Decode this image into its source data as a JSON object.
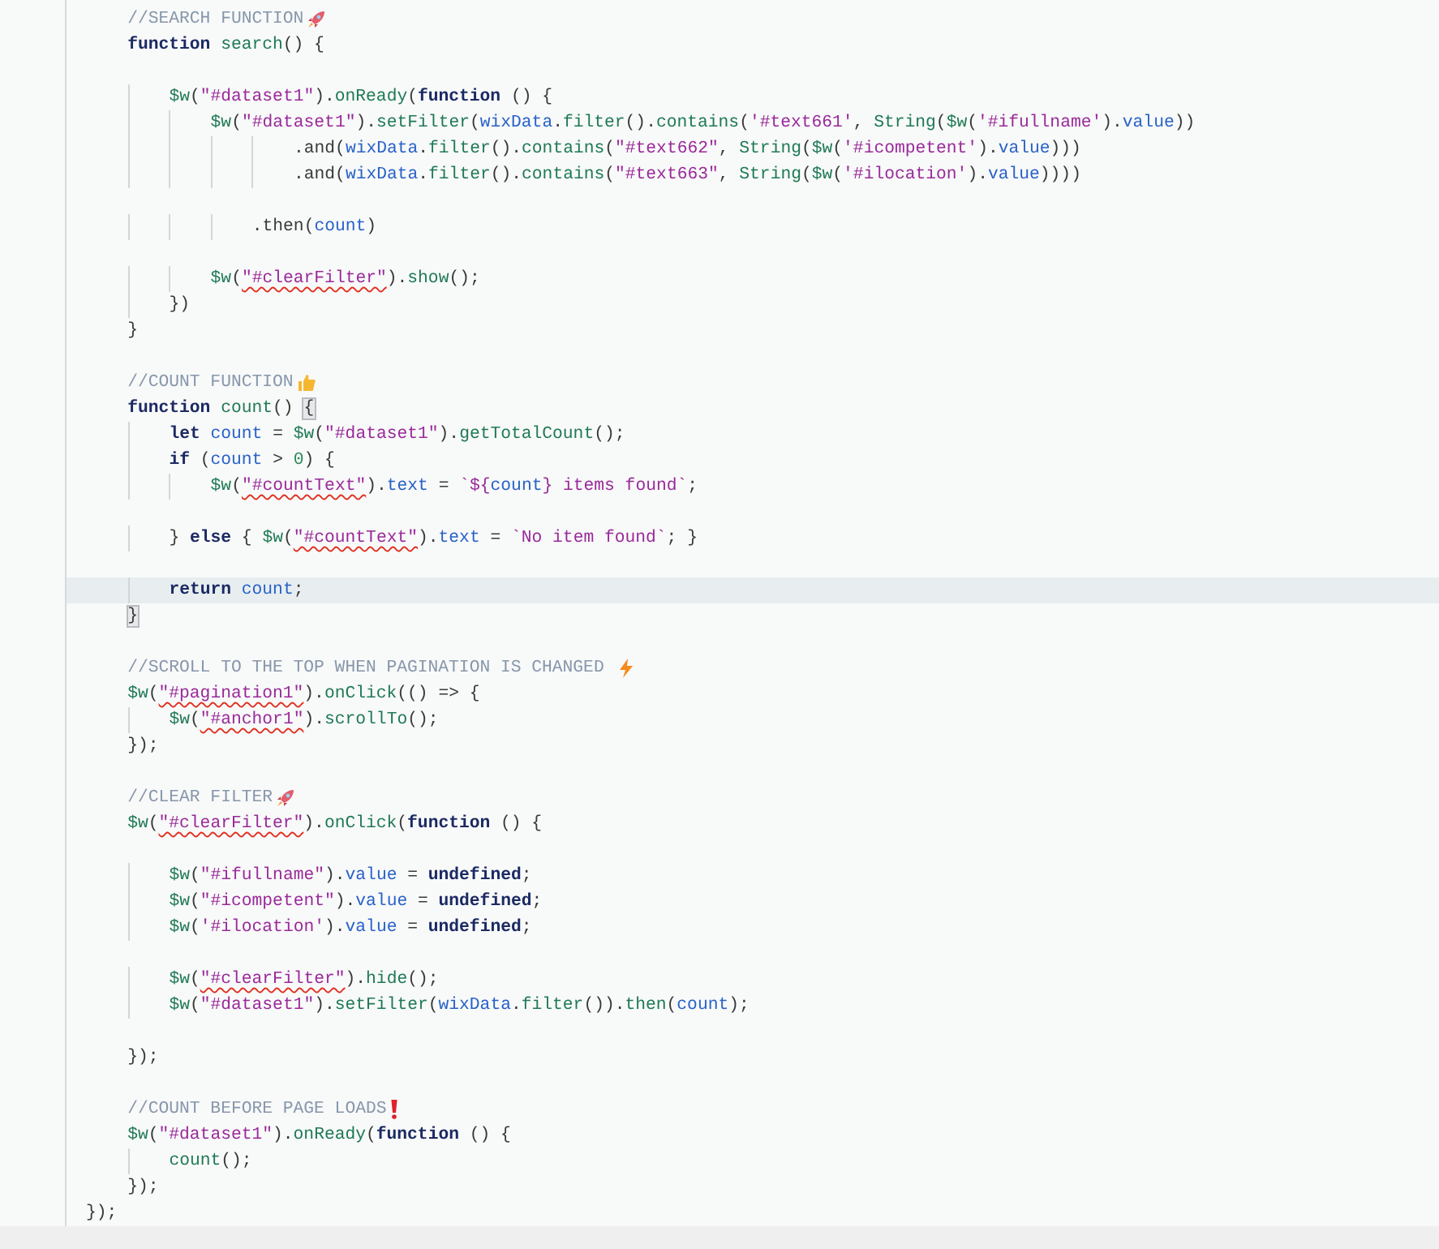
{
  "editor": {
    "lines": [
      {
        "kind": "rocket",
        "tokens": [
          {
            "kind": "c",
            "text": "    //SEARCH FUNCTION"
          }
        ]
      },
      {
        "kind": "code",
        "tokens": [
          {
            "kind": "k",
            "text": "    function"
          },
          {
            "kind": "f",
            "text": " search"
          },
          {
            "kind": "p",
            "text": "() {"
          }
        ]
      },
      {
        "kind": "blank"
      },
      {
        "kind": "code",
        "tokens": [
          {
            "kind": "f",
            "text": "        $w"
          },
          {
            "kind": "p",
            "text": "("
          },
          {
            "kind": "s",
            "text": "\"#dataset1\""
          },
          {
            "kind": "p",
            "text": ")."
          },
          {
            "kind": "f",
            "text": "onReady"
          },
          {
            "kind": "p",
            "text": "("
          },
          {
            "kind": "k",
            "text": "function"
          },
          {
            "kind": "p",
            "text": " () {"
          }
        ]
      },
      {
        "kind": "code",
        "tokens": [
          {
            "kind": "f",
            "text": "            $w"
          },
          {
            "kind": "p",
            "text": "("
          },
          {
            "kind": "s",
            "text": "\"#dataset1\""
          },
          {
            "kind": "p",
            "text": ")."
          },
          {
            "kind": "f",
            "text": "setFilter"
          },
          {
            "kind": "p",
            "text": "("
          },
          {
            "kind": "v",
            "text": "wixData"
          },
          {
            "kind": "p",
            "text": "."
          },
          {
            "kind": "f",
            "text": "filter"
          },
          {
            "kind": "p",
            "text": "()."
          },
          {
            "kind": "f",
            "text": "contains"
          },
          {
            "kind": "p",
            "text": "("
          },
          {
            "kind": "s",
            "text": "'#text661'"
          },
          {
            "kind": "p",
            "text": ", "
          },
          {
            "kind": "f",
            "text": "String"
          },
          {
            "kind": "p",
            "text": "("
          },
          {
            "kind": "f",
            "text": "$w"
          },
          {
            "kind": "p",
            "text": "("
          },
          {
            "kind": "s",
            "text": "'#ifullname'"
          },
          {
            "kind": "p",
            "text": ")."
          },
          {
            "kind": "v",
            "text": "value"
          },
          {
            "kind": "p",
            "text": "))"
          }
        ]
      },
      {
        "kind": "code",
        "tokens": [
          {
            "kind": "p",
            "text": "                    .and("
          },
          {
            "kind": "v",
            "text": "wixData"
          },
          {
            "kind": "p",
            "text": "."
          },
          {
            "kind": "f",
            "text": "filter"
          },
          {
            "kind": "p",
            "text": "()."
          },
          {
            "kind": "f",
            "text": "contains"
          },
          {
            "kind": "p",
            "text": "("
          },
          {
            "kind": "s",
            "text": "\"#text662\""
          },
          {
            "kind": "p",
            "text": ", "
          },
          {
            "kind": "f",
            "text": "String"
          },
          {
            "kind": "p",
            "text": "("
          },
          {
            "kind": "f",
            "text": "$w"
          },
          {
            "kind": "p",
            "text": "("
          },
          {
            "kind": "s",
            "text": "'#icompetent'"
          },
          {
            "kind": "p",
            "text": ")."
          },
          {
            "kind": "v",
            "text": "value"
          },
          {
            "kind": "p",
            "text": ")))"
          }
        ]
      },
      {
        "kind": "code",
        "tokens": [
          {
            "kind": "p",
            "text": "                    .and("
          },
          {
            "kind": "v",
            "text": "wixData"
          },
          {
            "kind": "p",
            "text": "."
          },
          {
            "kind": "f",
            "text": "filter"
          },
          {
            "kind": "p",
            "text": "()."
          },
          {
            "kind": "f",
            "text": "contains"
          },
          {
            "kind": "p",
            "text": "("
          },
          {
            "kind": "s",
            "text": "\"#text663\""
          },
          {
            "kind": "p",
            "text": ", "
          },
          {
            "kind": "f",
            "text": "String"
          },
          {
            "kind": "p",
            "text": "("
          },
          {
            "kind": "f",
            "text": "$w"
          },
          {
            "kind": "p",
            "text": "("
          },
          {
            "kind": "s",
            "text": "'#ilocation'"
          },
          {
            "kind": "p",
            "text": ")."
          },
          {
            "kind": "v",
            "text": "value"
          },
          {
            "kind": "p",
            "text": "))))"
          }
        ]
      },
      {
        "kind": "blank"
      },
      {
        "kind": "code",
        "tokens": [
          {
            "kind": "p",
            "text": "                .then("
          },
          {
            "kind": "v",
            "text": "count"
          },
          {
            "kind": "p",
            "text": ")"
          }
        ]
      },
      {
        "kind": "blank"
      },
      {
        "kind": "code",
        "tokens": [
          {
            "kind": "f",
            "text": "            $w"
          },
          {
            "kind": "p",
            "text": "("
          },
          {
            "kind": "e",
            "text": "\"#clearFilter\""
          },
          {
            "kind": "p",
            "text": ")."
          },
          {
            "kind": "f",
            "text": "show"
          },
          {
            "kind": "p",
            "text": "();"
          }
        ]
      },
      {
        "kind": "code",
        "tokens": [
          {
            "kind": "p",
            "text": "        })"
          }
        ]
      },
      {
        "kind": "code",
        "tokens": [
          {
            "kind": "p",
            "text": "    }"
          }
        ]
      },
      {
        "kind": "blank"
      },
      {
        "kind": "thumb",
        "tokens": [
          {
            "kind": "c",
            "text": "    //COUNT FUNCTION"
          }
        ]
      },
      {
        "kind": "code",
        "tokens": [
          {
            "kind": "k",
            "text": "    function"
          },
          {
            "kind": "f",
            "text": " count"
          },
          {
            "kind": "p",
            "text": "() "
          },
          {
            "kind": "m",
            "text": "{"
          }
        ]
      },
      {
        "kind": "code",
        "tokens": [
          {
            "kind": "k",
            "text": "        let"
          },
          {
            "kind": "v",
            "text": " count"
          },
          {
            "kind": "p",
            "text": " = "
          },
          {
            "kind": "f",
            "text": "$w"
          },
          {
            "kind": "p",
            "text": "("
          },
          {
            "kind": "s",
            "text": "\"#dataset1\""
          },
          {
            "kind": "p",
            "text": ")."
          },
          {
            "kind": "f",
            "text": "getTotalCount"
          },
          {
            "kind": "p",
            "text": "();"
          }
        ]
      },
      {
        "kind": "code",
        "tokens": [
          {
            "kind": "k",
            "text": "        if"
          },
          {
            "kind": "p",
            "text": " ("
          },
          {
            "kind": "v",
            "text": "count"
          },
          {
            "kind": "p",
            "text": " > "
          },
          {
            "kind": "n",
            "text": "0"
          },
          {
            "kind": "p",
            "text": ") {"
          }
        ]
      },
      {
        "kind": "code",
        "tokens": [
          {
            "kind": "f",
            "text": "            $w"
          },
          {
            "kind": "p",
            "text": "("
          },
          {
            "kind": "e",
            "text": "\"#countText\""
          },
          {
            "kind": "p",
            "text": ")."
          },
          {
            "kind": "v",
            "text": "text"
          },
          {
            "kind": "p",
            "text": " = "
          },
          {
            "kind": "s",
            "text": "`${"
          },
          {
            "kind": "v",
            "text": "count"
          },
          {
            "kind": "s",
            "text": "} items found`"
          },
          {
            "kind": "p",
            "text": ";"
          }
        ]
      },
      {
        "kind": "blank"
      },
      {
        "kind": "code",
        "tokens": [
          {
            "kind": "p",
            "text": "        } "
          },
          {
            "kind": "k",
            "text": "else"
          },
          {
            "kind": "p",
            "text": " { "
          },
          {
            "kind": "f",
            "text": "$w"
          },
          {
            "kind": "p",
            "text": "("
          },
          {
            "kind": "e",
            "text": "\"#countText\""
          },
          {
            "kind": "p",
            "text": ")."
          },
          {
            "kind": "v",
            "text": "text"
          },
          {
            "kind": "p",
            "text": " = "
          },
          {
            "kind": "s",
            "text": "`No item found`"
          },
          {
            "kind": "p",
            "text": "; }"
          }
        ]
      },
      {
        "kind": "blank"
      },
      {
        "kind": "code",
        "highlighted": true,
        "tokens": [
          {
            "kind": "k",
            "text": "        return"
          },
          {
            "kind": "v",
            "text": " count"
          },
          {
            "kind": "p",
            "text": ";"
          }
        ]
      },
      {
        "kind": "code",
        "tokens": [
          {
            "kind": "m",
            "text": "    }"
          }
        ]
      },
      {
        "kind": "blank"
      },
      {
        "kind": "bolt",
        "tokens": [
          {
            "kind": "c",
            "text": "    //SCROLL TO THE TOP WHEN PAGINATION IS CHANGED"
          }
        ]
      },
      {
        "kind": "code",
        "tokens": [
          {
            "kind": "f",
            "text": "    $w"
          },
          {
            "kind": "p",
            "text": "("
          },
          {
            "kind": "e",
            "text": "\"#pagination1\""
          },
          {
            "kind": "p",
            "text": ")."
          },
          {
            "kind": "f",
            "text": "onClick"
          },
          {
            "kind": "p",
            "text": "(() => {"
          }
        ]
      },
      {
        "kind": "code",
        "tokens": [
          {
            "kind": "f",
            "text": "        $w"
          },
          {
            "kind": "p",
            "text": "("
          },
          {
            "kind": "e",
            "text": "\"#anchor1\""
          },
          {
            "kind": "p",
            "text": ")."
          },
          {
            "kind": "f",
            "text": "scrollTo"
          },
          {
            "kind": "p",
            "text": "();"
          }
        ]
      },
      {
        "kind": "code",
        "tokens": [
          {
            "kind": "p",
            "text": "    });"
          }
        ]
      },
      {
        "kind": "blank"
      },
      {
        "kind": "rocket",
        "tokens": [
          {
            "kind": "c",
            "text": "    //CLEAR FILTER"
          }
        ]
      },
      {
        "kind": "code",
        "tokens": [
          {
            "kind": "f",
            "text": "    $w"
          },
          {
            "kind": "p",
            "text": "("
          },
          {
            "kind": "e",
            "text": "\"#clearFilter\""
          },
          {
            "kind": "p",
            "text": ")."
          },
          {
            "kind": "f",
            "text": "onClick"
          },
          {
            "kind": "p",
            "text": "("
          },
          {
            "kind": "k",
            "text": "function"
          },
          {
            "kind": "p",
            "text": " () {"
          }
        ]
      },
      {
        "kind": "blank"
      },
      {
        "kind": "code",
        "tokens": [
          {
            "kind": "f",
            "text": "        $w"
          },
          {
            "kind": "p",
            "text": "("
          },
          {
            "kind": "s",
            "text": "\"#ifullname\""
          },
          {
            "kind": "p",
            "text": ")."
          },
          {
            "kind": "v",
            "text": "value"
          },
          {
            "kind": "p",
            "text": " = "
          },
          {
            "kind": "k",
            "text": "undefined"
          },
          {
            "kind": "p",
            "text": ";"
          }
        ]
      },
      {
        "kind": "code",
        "tokens": [
          {
            "kind": "f",
            "text": "        $w"
          },
          {
            "kind": "p",
            "text": "("
          },
          {
            "kind": "s",
            "text": "\"#icompetent\""
          },
          {
            "kind": "p",
            "text": ")."
          },
          {
            "kind": "v",
            "text": "value"
          },
          {
            "kind": "p",
            "text": " = "
          },
          {
            "kind": "k",
            "text": "undefined"
          },
          {
            "kind": "p",
            "text": ";"
          }
        ]
      },
      {
        "kind": "code",
        "tokens": [
          {
            "kind": "f",
            "text": "        $w"
          },
          {
            "kind": "p",
            "text": "("
          },
          {
            "kind": "s",
            "text": "'#ilocation'"
          },
          {
            "kind": "p",
            "text": ")."
          },
          {
            "kind": "v",
            "text": "value"
          },
          {
            "kind": "p",
            "text": " = "
          },
          {
            "kind": "k",
            "text": "undefined"
          },
          {
            "kind": "p",
            "text": ";"
          }
        ]
      },
      {
        "kind": "blank"
      },
      {
        "kind": "code",
        "tokens": [
          {
            "kind": "f",
            "text": "        $w"
          },
          {
            "kind": "p",
            "text": "("
          },
          {
            "kind": "e",
            "text": "\"#clearFilter\""
          },
          {
            "kind": "p",
            "text": ")."
          },
          {
            "kind": "f",
            "text": "hide"
          },
          {
            "kind": "p",
            "text": "();"
          }
        ]
      },
      {
        "kind": "code",
        "tokens": [
          {
            "kind": "f",
            "text": "        $w"
          },
          {
            "kind": "p",
            "text": "("
          },
          {
            "kind": "s",
            "text": "\"#dataset1\""
          },
          {
            "kind": "p",
            "text": ")."
          },
          {
            "kind": "f",
            "text": "setFilter"
          },
          {
            "kind": "p",
            "text": "("
          },
          {
            "kind": "v",
            "text": "wixData"
          },
          {
            "kind": "p",
            "text": "."
          },
          {
            "kind": "f",
            "text": "filter"
          },
          {
            "kind": "p",
            "text": "())."
          },
          {
            "kind": "f",
            "text": "then"
          },
          {
            "kind": "p",
            "text": "("
          },
          {
            "kind": "v",
            "text": "count"
          },
          {
            "kind": "p",
            "text": ");"
          }
        ]
      },
      {
        "kind": "blank"
      },
      {
        "kind": "code",
        "tokens": [
          {
            "kind": "p",
            "text": "    });"
          }
        ]
      },
      {
        "kind": "blank"
      },
      {
        "kind": "bang",
        "tokens": [
          {
            "kind": "c",
            "text": "    //COUNT BEFORE PAGE LOADS"
          }
        ]
      },
      {
        "kind": "code",
        "tokens": [
          {
            "kind": "f",
            "text": "    $w"
          },
          {
            "kind": "p",
            "text": "("
          },
          {
            "kind": "s",
            "text": "\"#dataset1\""
          },
          {
            "kind": "p",
            "text": ")."
          },
          {
            "kind": "f",
            "text": "onReady"
          },
          {
            "kind": "p",
            "text": "("
          },
          {
            "kind": "k",
            "text": "function"
          },
          {
            "kind": "p",
            "text": " () {"
          }
        ]
      },
      {
        "kind": "code",
        "tokens": [
          {
            "kind": "f",
            "text": "        count"
          },
          {
            "kind": "p",
            "text": "();"
          }
        ]
      },
      {
        "kind": "code",
        "tokens": [
          {
            "kind": "p",
            "text": "    });"
          }
        ]
      },
      {
        "kind": "code",
        "tokens": [
          {
            "kind": "p",
            "text": "});"
          }
        ]
      }
    ]
  }
}
